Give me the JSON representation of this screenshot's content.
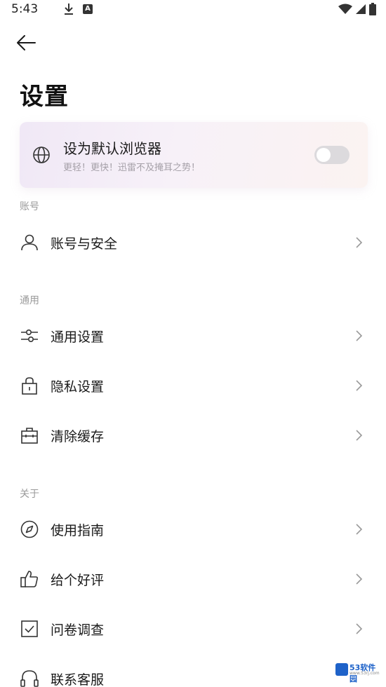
{
  "status_bar": {
    "time": "5:43"
  },
  "header": {
    "title": "设置"
  },
  "default_browser_card": {
    "title": "设为默认浏览器",
    "subtitle": "更轻！更快！迅雷不及掩耳之势！",
    "toggle_on": false
  },
  "sections": [
    {
      "label": "账号",
      "items": [
        {
          "label": "账号与安全",
          "icon": "user-icon"
        }
      ]
    },
    {
      "label": "通用",
      "items": [
        {
          "label": "通用设置",
          "icon": "sliders-icon"
        },
        {
          "label": "隐私设置",
          "icon": "lock-icon"
        },
        {
          "label": "清除缓存",
          "icon": "toolbox-icon"
        }
      ]
    },
    {
      "label": "关于",
      "items": [
        {
          "label": "使用指南",
          "icon": "compass-icon"
        },
        {
          "label": "给个好评",
          "icon": "thumbs-up-icon"
        },
        {
          "label": "问卷调查",
          "icon": "checkbox-icon"
        },
        {
          "label": "联系客服",
          "icon": "headset-icon"
        }
      ]
    }
  ],
  "watermark": {
    "text": "53软件园",
    "url": "www.53rj.com"
  }
}
